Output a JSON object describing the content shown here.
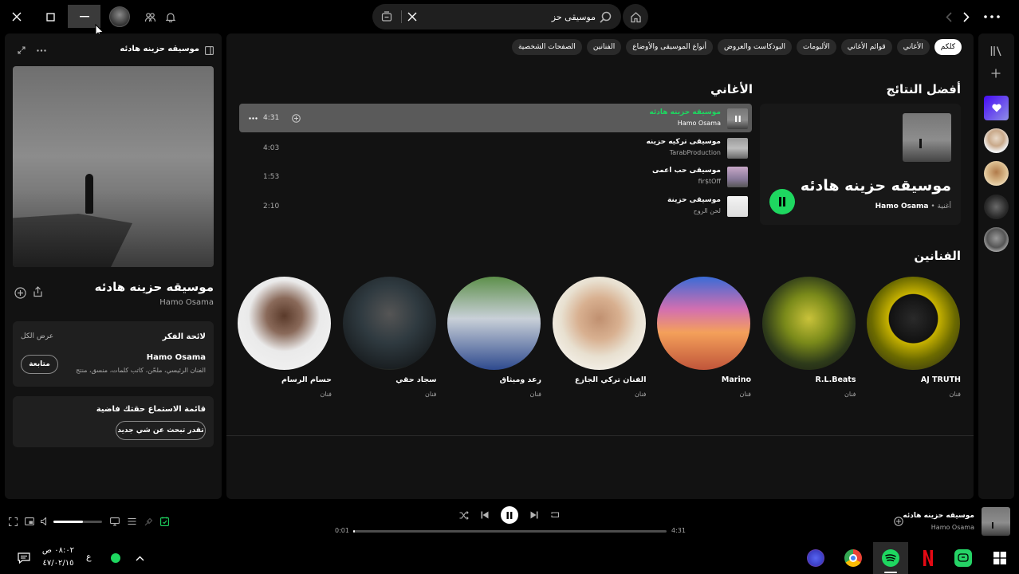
{
  "topbar": {
    "search_value": "موسيقى حز"
  },
  "sidebar": {
    "title": "موسيقه حزينه هادئه",
    "track_title": "موسيقه حزينه هادئه",
    "artist": "Hamo Osama",
    "about": {
      "header": "لائحة الفكر",
      "show_all": "عرض الكل",
      "artist_name": "Hamo Osama",
      "artist_roles": "الفنان الرئيسي، ملحّن، كاتب كلمات، منسق، منتج",
      "follow_label": "متابعة"
    },
    "queue": {
      "title": "قائمة الاستماع حقتك فاضية",
      "button_label": "تقدر تبحث عن شي جديد"
    }
  },
  "filters": [
    "كلكم",
    "الأغاني",
    "قوائم الأغاني",
    "الألبومات",
    "البودكاست والعروض",
    "أنواع الموسيقى والأوضاع",
    "الفنانين",
    "الصفحات الشخصية"
  ],
  "top_result": {
    "heading": "أفضل النتائج",
    "title": "موسيقه حزينه هادئه",
    "type": "أغنية",
    "artist": "Hamo Osama"
  },
  "songs": {
    "heading": "الأغاني",
    "items": [
      {
        "title": "موسيقه حزينه هادئه",
        "artist": "Hamo Osama",
        "duration": "4:31",
        "playing": true
      },
      {
        "title": "موسيقى تركيه حزينه",
        "artist": "TarabProduction",
        "duration": "4:03",
        "playing": false
      },
      {
        "title": "موسيقى حب اعمى",
        "artist": "fir$tOff",
        "duration": "1:53",
        "playing": false
      },
      {
        "title": "موسيقى حزينة",
        "artist": "لحن الروح",
        "duration": "2:10",
        "playing": false
      }
    ]
  },
  "artists": {
    "heading": "الفنانين",
    "items": [
      {
        "name": "AJ TRUTH",
        "type": "فنان"
      },
      {
        "name": "R.L.Beats",
        "type": "فنان"
      },
      {
        "name": "Marino",
        "type": "فنان"
      },
      {
        "name": "الفنان تركي الجازع",
        "type": "فنان"
      },
      {
        "name": "رعد وميثاق",
        "type": "فنان"
      },
      {
        "name": "سجاد حقي",
        "type": "فنان"
      },
      {
        "name": "حسام الرسام",
        "type": "فنان"
      }
    ]
  },
  "player": {
    "track_title": "موسيقه حزينه هادئه",
    "artist": "Hamo Osama",
    "elapsed": "0:01",
    "total": "4:31",
    "progress": 0.004,
    "volume": 0.6
  },
  "taskbar": {
    "time": "٠٨:٠٢ ص",
    "date": "٤٧/٠٢/١٥",
    "lang": "ع"
  },
  "colors": {
    "accent": "#1ed760",
    "bg": "#000000",
    "panel": "#121212"
  }
}
